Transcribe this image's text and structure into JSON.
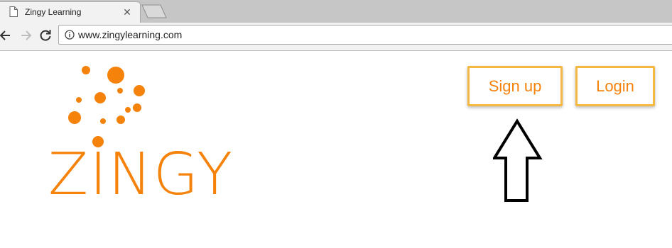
{
  "browser": {
    "tab": {
      "title": "Zingy Learning",
      "favicon_icon": "page-icon",
      "close_icon": "close-icon"
    },
    "toolbar": {
      "back_icon": "arrow-left-icon",
      "forward_icon": "arrow-right-icon",
      "reload_icon": "reload-icon",
      "site_info_icon": "info-icon",
      "url": "www.zingylearning.com"
    }
  },
  "page": {
    "logo": {
      "text": "ZINGY"
    },
    "buttons": {
      "signup_label": "Sign up",
      "login_label": "Login"
    },
    "annotation": {
      "icon": "arrow-up-outline-icon",
      "points_to": "Sign up"
    }
  },
  "colors": {
    "brand_orange": "#f5820a",
    "button_border": "#f4b942",
    "tabstrip_bg": "#c6c6c6",
    "toolbar_bg": "#f2f2f2"
  }
}
